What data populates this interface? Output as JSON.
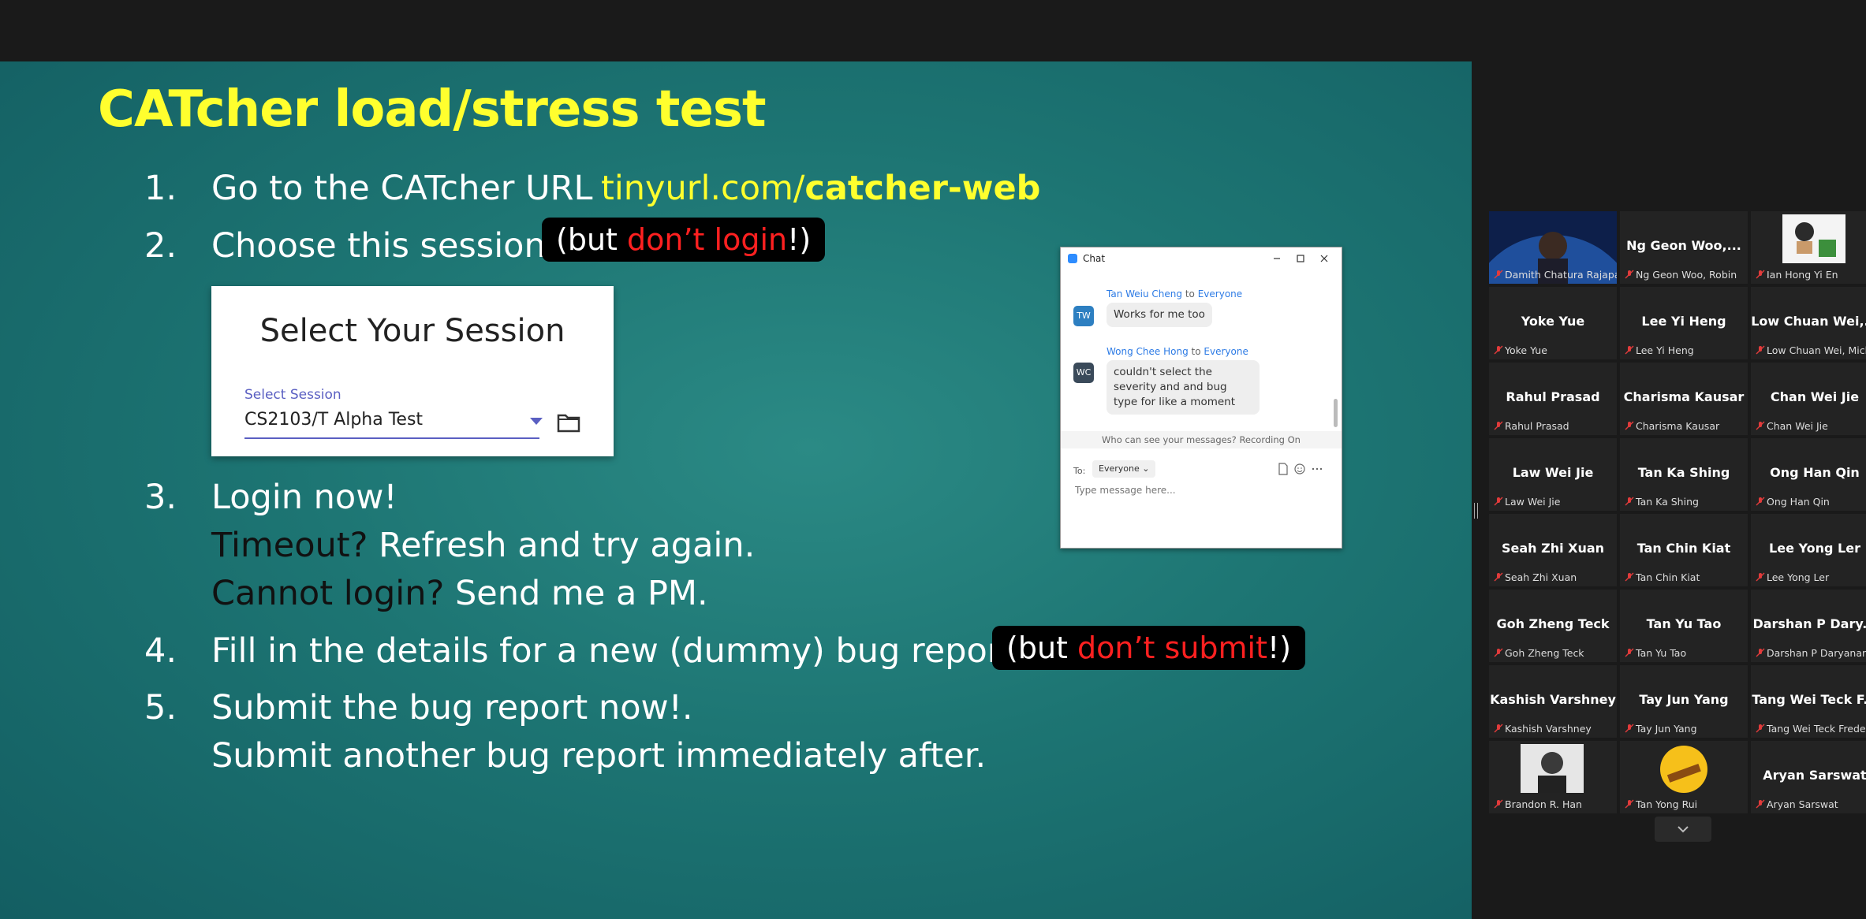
{
  "slide": {
    "title": "CATcher load/stress test",
    "steps": [
      {
        "num": "1.",
        "text": "Go to the CATcher URL",
        "link_prefix": "tinyurl.com/",
        "link_bold": "catcher-web"
      },
      {
        "num": "2.",
        "text": "Choose this session",
        "note_open": "(but ",
        "note_red": "don’t login",
        "note_close": "!)"
      },
      {
        "num": "3.",
        "text": "Login now!",
        "line2_dark": "Timeout?",
        "line2_rest": " Refresh and try again.",
        "line3_dark": "Cannot login?",
        "line3_rest": " Send me a PM."
      },
      {
        "num": "4.",
        "text": "Fill in the details for a new (dummy) bug report.",
        "note_open": "(but ",
        "note_red": "don’t submit",
        "note_close": "!)"
      },
      {
        "num": "5.",
        "text": "Submit the bug report now!.",
        "line2": "Submit another bug report immediately after."
      }
    ],
    "session_card": {
      "title": "Select Your Session",
      "label": "Select Session",
      "value": "CS2103/T Alpha Test"
    }
  },
  "chat": {
    "title": "Chat",
    "messages": [
      {
        "from": "Tan Weiu Cheng",
        "to_word": "to",
        "to": "Everyone",
        "initials": "TW",
        "text": "Works for me too",
        "avatar_color": "#2d7fc1"
      },
      {
        "from": "Wong Chee Hong",
        "to_word": "to",
        "to": "Everyone",
        "initials": "WC",
        "text": "couldn't select the severity and and bug type for like a moment",
        "avatar_color": "#3a4a5a"
      }
    ],
    "notice": "Who can see your messages? Recording On",
    "to_label": "To:",
    "recipient": "Everyone",
    "input_placeholder": "Type message here..."
  },
  "participants": [
    {
      "name": "",
      "label": "Damith Chatura Rajapakse"
    },
    {
      "name": "Ng Geon Woo,...",
      "label": "Ng Geon Woo, Robin"
    },
    {
      "name": "",
      "label": "Ian Hong Yi En"
    },
    {
      "name": "Yoke Yue",
      "label": "Yoke Yue"
    },
    {
      "name": "Lee Yi Heng",
      "label": "Lee Yi Heng"
    },
    {
      "name": "Low Chuan Wei,...",
      "label": "Low Chuan Wei, Mich"
    },
    {
      "name": "Rahul Prasad",
      "label": "Rahul Prasad"
    },
    {
      "name": "Charisma Kausar",
      "label": "Charisma Kausar"
    },
    {
      "name": "Chan Wei Jie",
      "label": "Chan Wei Jie"
    },
    {
      "name": "Law Wei Jie",
      "label": "Law Wei Jie"
    },
    {
      "name": "Tan Ka Shing",
      "label": "Tan Ka Shing"
    },
    {
      "name": "Ong Han Qin",
      "label": "Ong Han Qin"
    },
    {
      "name": "Seah Zhi Xuan",
      "label": "Seah Zhi Xuan"
    },
    {
      "name": "Tan Chin Kiat",
      "label": "Tan Chin Kiat"
    },
    {
      "name": "Lee Yong Ler",
      "label": "Lee Yong Ler"
    },
    {
      "name": "Goh Zheng Teck",
      "label": "Goh Zheng Teck"
    },
    {
      "name": "Tan Yu Tao",
      "label": "Tan Yu Tao"
    },
    {
      "name": "Darshan P Dary...",
      "label": "Darshan P Daryanani"
    },
    {
      "name": "Kashish Varshney",
      "label": "Kashish Varshney"
    },
    {
      "name": "Tay Jun Yang",
      "label": "Tay Jun Yang"
    },
    {
      "name": "Tang Wei Teck F...",
      "label": "Tang Wei Teck Frederi"
    },
    {
      "name": "",
      "label": "Brandon R. Han"
    },
    {
      "name": "",
      "label": "Tan Yong Rui"
    },
    {
      "name": "Aryan Sarswat",
      "label": "Aryan Sarswat"
    }
  ]
}
